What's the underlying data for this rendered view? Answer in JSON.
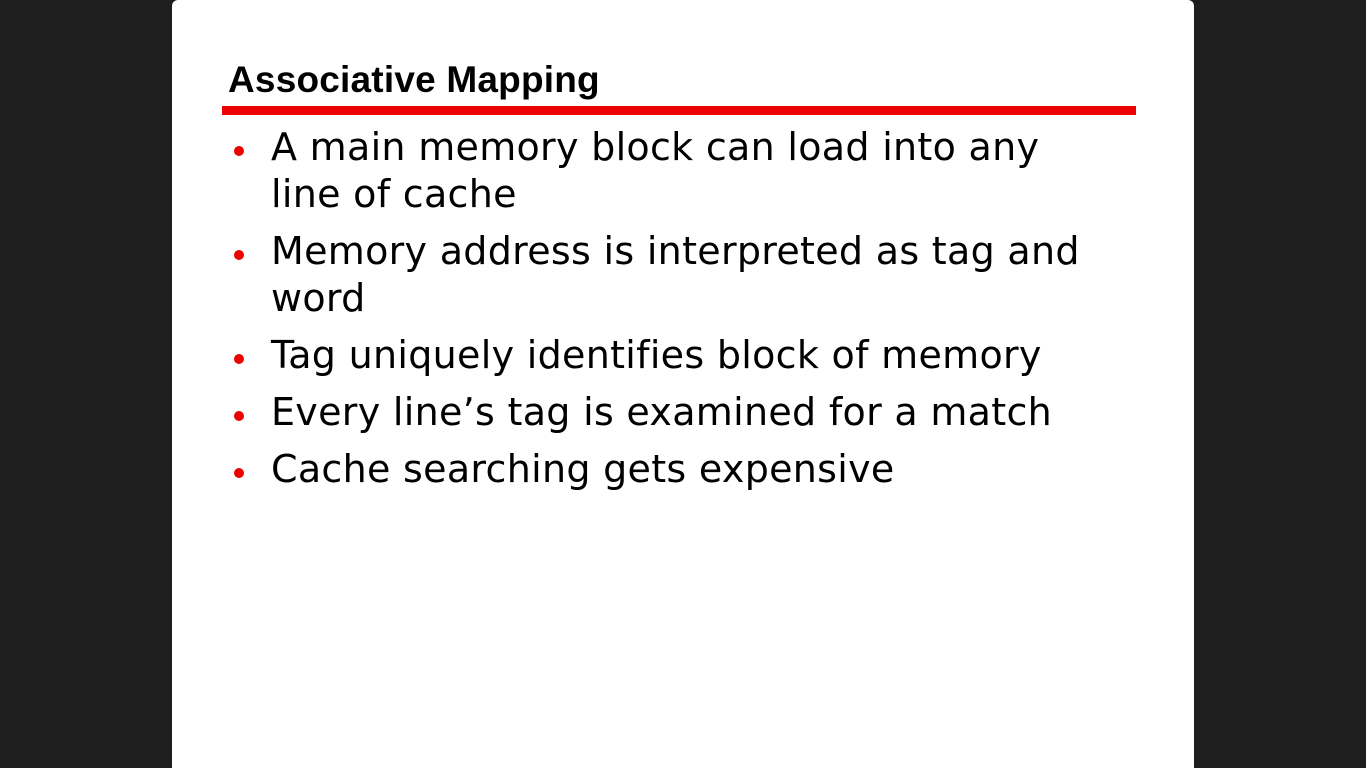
{
  "slide": {
    "title": "Associative Mapping",
    "bullets": [
      "A main memory block can load into any line of cache",
      "Memory address is interpreted as tag and word",
      "Tag uniquely identifies block of memory",
      "Every line’s tag is examined for a match",
      "Cache searching gets expensive"
    ]
  },
  "colors": {
    "accent": "#ec0000",
    "background": "#1e1e1e",
    "slide": "#ffffff",
    "text": "#000000"
  }
}
